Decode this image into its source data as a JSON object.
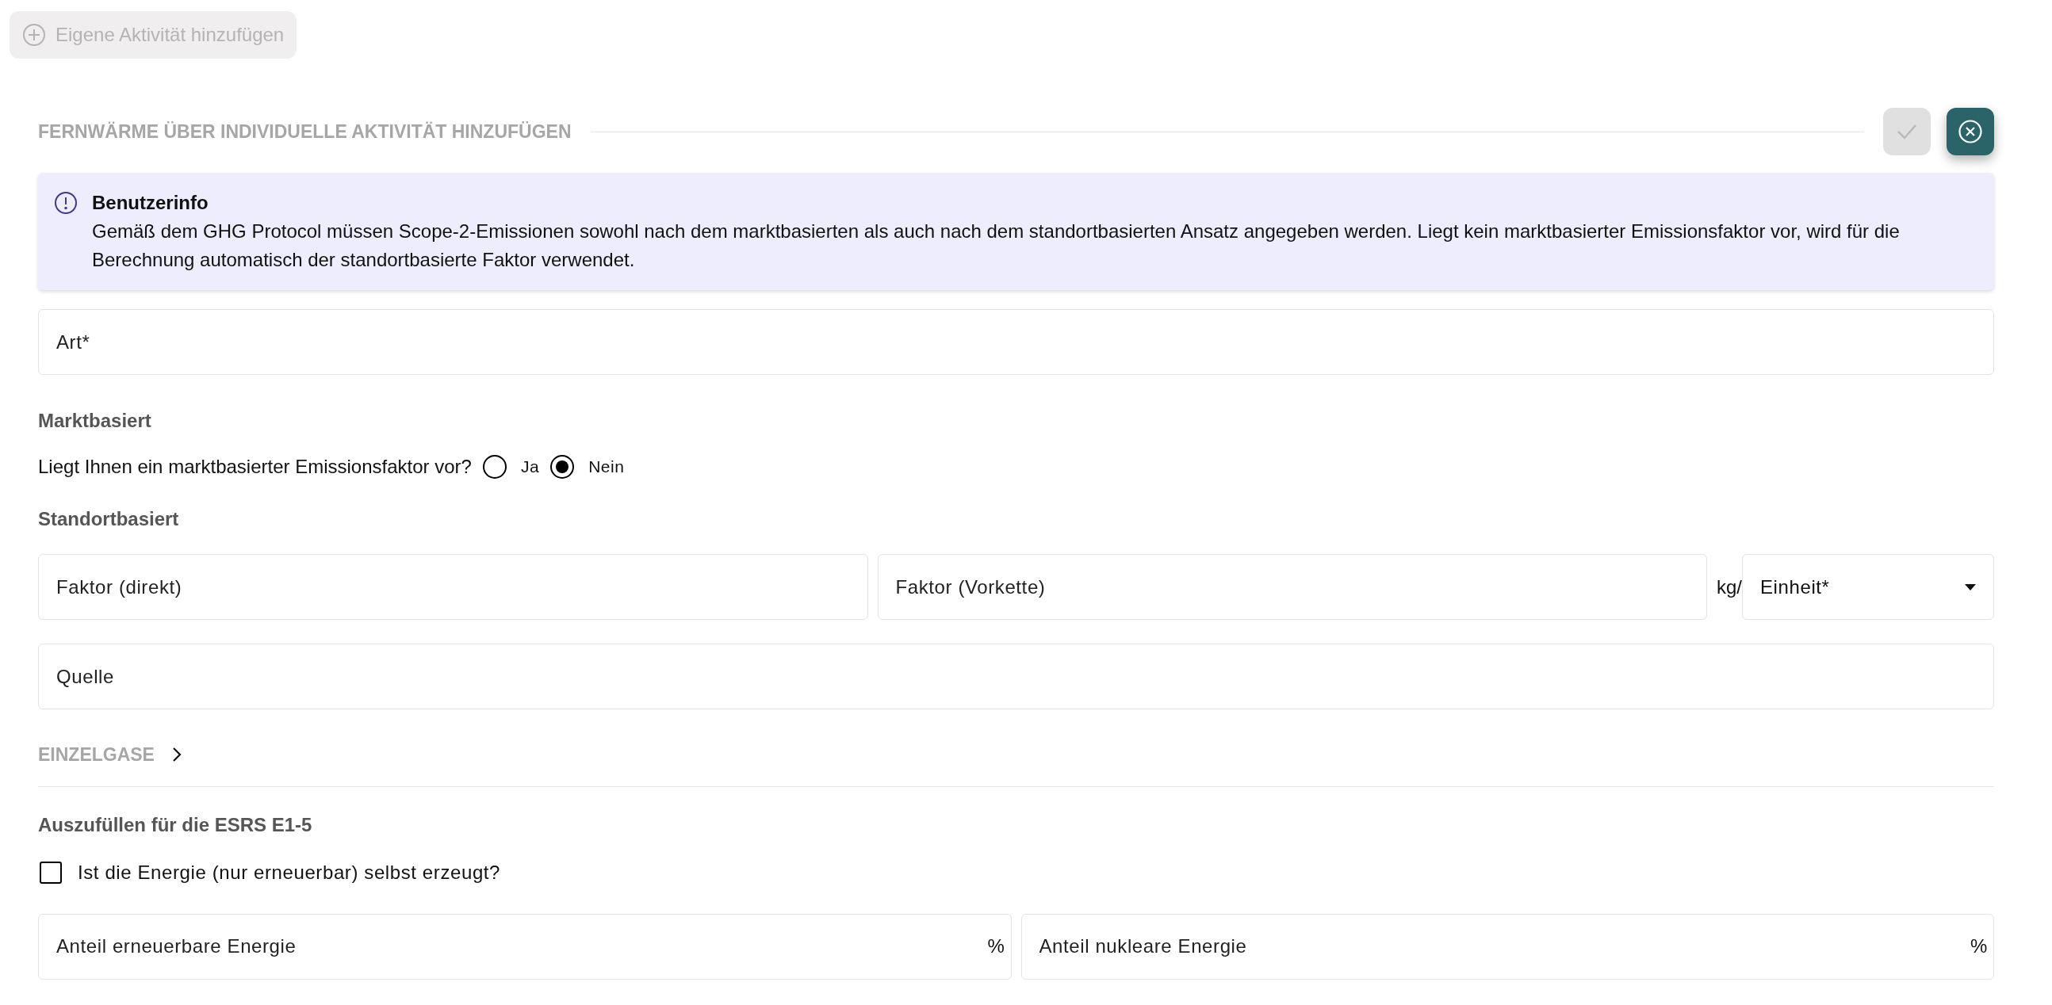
{
  "add_button": {
    "label": "Eigene Aktivität hinzufügen",
    "disabled": true
  },
  "section": {
    "title": "FERNWÄRME ÜBER INDIVIDUELLE AKTIVITÄT HINZUFÜGEN",
    "confirm_disabled": true
  },
  "info": {
    "title": "Benutzerinfo",
    "text": "Gemäß dem GHG Protocol müssen Scope-2-Emissionen sowohl nach dem marktbasierten als auch nach dem standortbasierten Ansatz angegeben werden. Liegt kein marktbasierter Emissionsfaktor vor, wird für die Berechnung automatisch der standortbasierte Faktor verwendet."
  },
  "art_field": {
    "placeholder": "Art*"
  },
  "market": {
    "heading": "Marktbasiert",
    "question": "Liegt Ihnen ein marktbasierter Emissionsfaktor vor?",
    "options": [
      {
        "label": "Ja",
        "selected": false
      },
      {
        "label": "Nein",
        "selected": true
      }
    ]
  },
  "location": {
    "heading": "Standortbasiert",
    "factor_direct": {
      "placeholder": "Faktor (direkt)"
    },
    "factor_chain": {
      "placeholder": "Faktor (Vorkette)"
    },
    "unit_prefix": "kg/",
    "unit_select": {
      "label": "Einheit*"
    },
    "source": {
      "placeholder": "Quelle"
    }
  },
  "einzelgase": {
    "label": "EINZELGASE",
    "expanded": false
  },
  "esrs": {
    "heading": "Auszufüllen für die ESRS E1-5",
    "self_generated": {
      "label": "Ist die Energie (nur erneuerbar) selbst erzeugt?",
      "checked": false
    },
    "fields": [
      {
        "placeholder": "Anteil erneuerbare Energie",
        "suffix": "%"
      },
      {
        "placeholder": "Anteil nukleare Energie",
        "suffix": "%"
      }
    ]
  }
}
